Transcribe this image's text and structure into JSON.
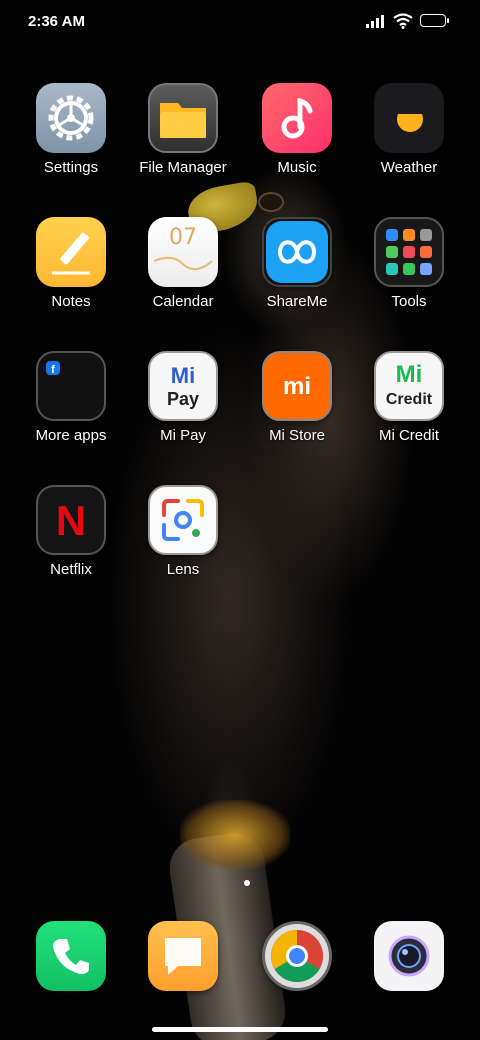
{
  "status_bar": {
    "time": "2:36 AM"
  },
  "apps": [
    {
      "id": "settings",
      "label": "Settings",
      "icon": "settings-gear-icon"
    },
    {
      "id": "file_manager",
      "label": "File Manager",
      "icon": "folder-icon"
    },
    {
      "id": "music",
      "label": "Music",
      "icon": "music-note-icon"
    },
    {
      "id": "weather",
      "label": "Weather",
      "icon": "weather-sun-icon"
    },
    {
      "id": "notes",
      "label": "Notes",
      "icon": "notes-pencil-icon"
    },
    {
      "id": "calendar",
      "label": "Calendar",
      "icon": "calendar-icon",
      "date": "07"
    },
    {
      "id": "shareme",
      "label": "ShareMe",
      "icon": "infinity-icon"
    },
    {
      "id": "tools",
      "label": "Tools",
      "icon": "tools-folder-icon"
    },
    {
      "id": "more_apps",
      "label": "More apps",
      "icon": "apps-folder-icon"
    },
    {
      "id": "mi_pay",
      "label": "Mi Pay",
      "icon": "mi-pay-icon",
      "icon_text_top": "Mi",
      "icon_text_bottom": "Pay"
    },
    {
      "id": "mi_store",
      "label": "Mi Store",
      "icon": "mi-store-icon",
      "icon_text": "mi"
    },
    {
      "id": "mi_credit",
      "label": "Mi Credit",
      "icon": "mi-credit-icon",
      "icon_text_top": "Mi",
      "icon_text_bottom": "Credit"
    },
    {
      "id": "netflix",
      "label": "Netflix",
      "icon": "netflix-icon",
      "icon_text": "N"
    },
    {
      "id": "lens",
      "label": "Lens",
      "icon": "lens-icon"
    }
  ],
  "dock": [
    {
      "id": "phone",
      "icon": "phone-icon"
    },
    {
      "id": "messages",
      "icon": "message-icon"
    },
    {
      "id": "chrome",
      "icon": "chrome-icon"
    },
    {
      "id": "camera",
      "icon": "camera-icon"
    }
  ],
  "colors": {
    "netflix_red": "#e50914",
    "mi_store_orange": "#ff6900",
    "mi_credit_green": "#1db954",
    "mi_pay_blue": "#2e5bd8"
  }
}
